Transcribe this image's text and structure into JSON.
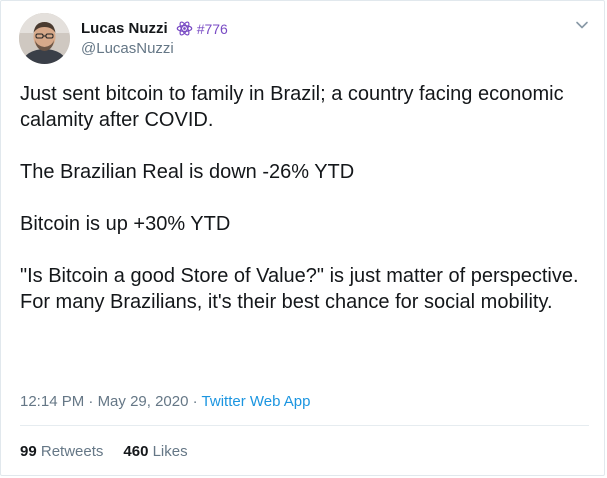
{
  "author": {
    "display_name": "Lucas Nuzzi",
    "badge_icon": "atom-icon",
    "badge_label": "#776",
    "handle": "@LucasNuzzi"
  },
  "tweet": {
    "paragraphs": [
      "Just sent bitcoin to family in Brazil; a country facing economic calamity after COVID.",
      "The Brazilian Real is down -26% YTD",
      "Bitcoin is up +30% YTD",
      "\"Is Bitcoin a good Store of Value?\" is just matter of perspective. For many Brazilians, it's their best chance for social mobility."
    ]
  },
  "meta": {
    "time": "12:14 PM",
    "separator": "·",
    "date": "May 29, 2020",
    "app": "Twitter Web App"
  },
  "stats": {
    "retweets_count": "99",
    "retweets_label": "Retweets",
    "likes_count": "460",
    "likes_label": "Likes"
  },
  "colors": {
    "link": "#1b95e0",
    "badge": "#794bc4",
    "muted": "#657786"
  }
}
